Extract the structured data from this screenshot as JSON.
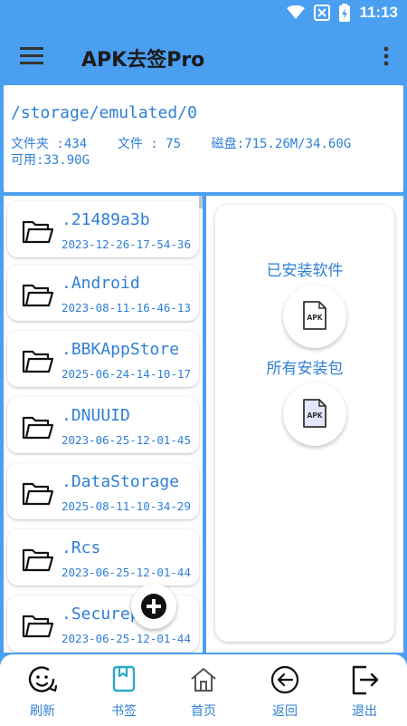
{
  "status": {
    "time": "11:13"
  },
  "appbar": {
    "title": "APK去签Pro"
  },
  "path_panel": {
    "path": "/storage/emulated/0",
    "folders": "文件夹 :434",
    "files": "文件 : 75",
    "disk": "磁盘:715.26M/34.60G",
    "available": "可用:33.90G"
  },
  "files": [
    {
      "name": ".21489a3b",
      "date": "2023-12-26-17-54-36"
    },
    {
      "name": ".Android",
      "date": "2023-08-11-16-46-13"
    },
    {
      "name": ".BBKAppStore",
      "date": "2025-06-24-14-10-17"
    },
    {
      "name": ".DNUUID",
      "date": "2023-06-25-12-01-45"
    },
    {
      "name": ".DataStorage",
      "date": "2025-08-11-10-34-29"
    },
    {
      "name": ".Rcs",
      "date": "2023-06-25-12-01-44"
    },
    {
      "name": ".Securep",
      "date": "2023-06-25-12-01-44"
    }
  ],
  "right_panel": {
    "installed_label": "已安装软件",
    "packages_label": "所有安装包",
    "apk_text": "APK"
  },
  "bottom_nav": [
    {
      "label": "刷新",
      "icon": "refresh-face-icon"
    },
    {
      "label": "书签",
      "icon": "bookmark-icon"
    },
    {
      "label": "首页",
      "icon": "home-icon"
    },
    {
      "label": "返回",
      "icon": "back-arrow-icon"
    },
    {
      "label": "退出",
      "icon": "exit-icon"
    }
  ],
  "colors": {
    "primary": "#4a9ff0",
    "text_blue": "#2f7fd6",
    "dark": "#1b1b1b"
  }
}
